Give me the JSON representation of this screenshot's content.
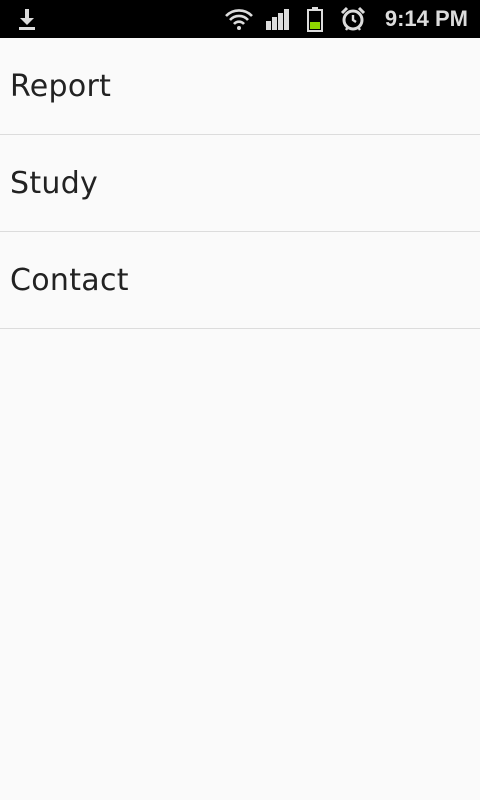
{
  "status_bar": {
    "time": "9:14 PM",
    "icons": [
      "download-icon",
      "wifi-icon",
      "signal-icon",
      "battery-icon",
      "alarm-icon"
    ],
    "battery_color": "#8fd400"
  },
  "menu": {
    "items": [
      {
        "label": "Report"
      },
      {
        "label": "Study"
      },
      {
        "label": "Contact"
      }
    ]
  }
}
